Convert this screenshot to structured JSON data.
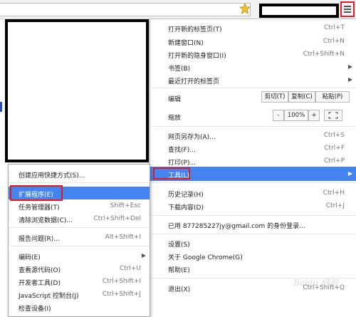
{
  "menu": {
    "items": [
      {
        "label": "打开新的标签页(T)",
        "shortcut": "Ctrl+T"
      },
      {
        "label": "新建窗口(N)",
        "shortcut": "Ctrl+N"
      },
      {
        "label": "打开新的隐身窗口(I)",
        "shortcut": "Ctrl+Shift+N"
      },
      {
        "label": "书签(B)"
      },
      {
        "label": "最近打开的标签页"
      }
    ],
    "edit": {
      "label": "编辑",
      "cut": "剪切(T)",
      "copy": "复制(C)",
      "paste": "粘贴(P)"
    },
    "zoom": {
      "label": "缩放",
      "minus": "-",
      "value": "100%",
      "plus": "+"
    },
    "page_items": [
      {
        "label": "网页另存为(A)...",
        "shortcut": "Ctrl+S"
      },
      {
        "label": "查找(F)...",
        "shortcut": "Ctrl+F"
      },
      {
        "label": "打印(P)...",
        "shortcut": "Ctrl+P"
      }
    ],
    "tools": {
      "label": "工具(L)"
    },
    "history_items": [
      {
        "label": "历史记录(H)",
        "shortcut": "Ctrl+H"
      },
      {
        "label": "下载内容(D)",
        "shortcut": "Ctrl+J"
      }
    ],
    "signin": "已用 877285227jy@gmail.com 的身份登录...",
    "settings_items": [
      {
        "label": "设置(S)"
      },
      {
        "label": "关于 Google Chrome(G)"
      },
      {
        "label": "帮助(E)"
      }
    ],
    "exit": {
      "label": "退出(X)",
      "shortcut": "Ctrl+Shift+Q"
    }
  },
  "submenu": {
    "create_shortcut": "创建应用快捷方式(S)...",
    "extensions": "扩展程序(E)",
    "task_manager": {
      "label": "任务管理器(T)",
      "shortcut": "Shift+Esc"
    },
    "clear_data": {
      "label": "清除浏览数据(C)...",
      "shortcut": "Ctrl+Shift+Del"
    },
    "report_issue": {
      "label": "报告问题(R)...",
      "shortcut": "Alt+Shift+I"
    },
    "encoding": "编码(E)",
    "view_source": {
      "label": "查看源代码(O)",
      "shortcut": "Ctrl+U"
    },
    "dev_tools": {
      "label": "开发者工具(D)",
      "shortcut": "Ctrl+Shift+I"
    },
    "js_console": {
      "label": "JavaScript 控制台(J)",
      "shortcut": "Ctrl+Shift+J"
    },
    "inspect_devices": "检查设备(I)"
  },
  "watermark": "Baidu 经验",
  "colors": {
    "highlight": "#4484f0",
    "annotation": "#e01b24"
  }
}
